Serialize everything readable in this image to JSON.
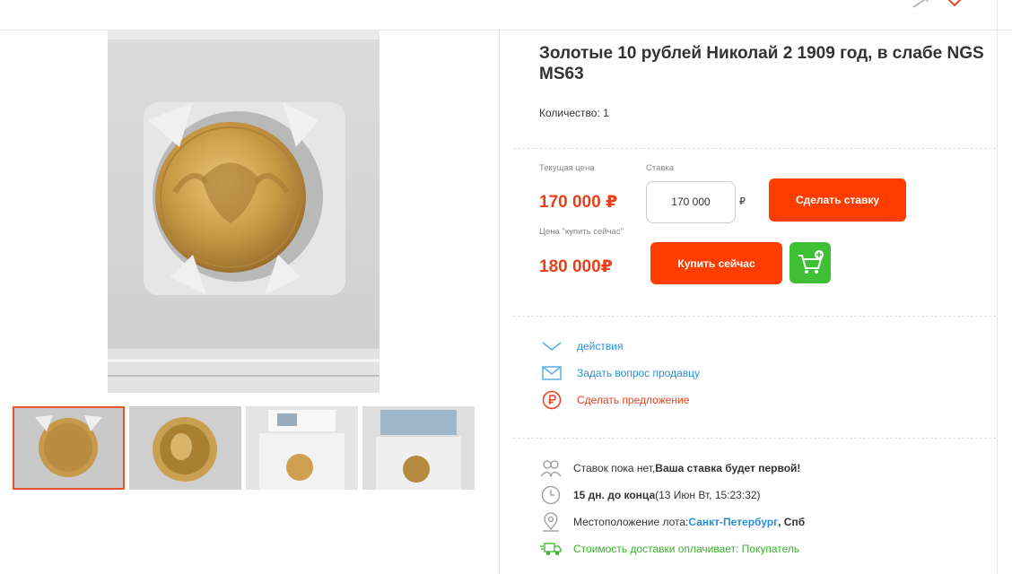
{
  "lot": {
    "title": "Золотые 10 рублей Николай 2 1909 год, в слабе NGS MS63",
    "quantity": "Количество: 1"
  },
  "pricing": {
    "current_label": "Текущая цена",
    "current_price": "170 000 ₽",
    "bid_label": "Ставка",
    "bid_value": "170 000",
    "bid_currency": "₽",
    "bid_button": "Сделать ставку",
    "buy_now_label": "Цена \"купить сейчас\"",
    "buy_now_price": "180 000₽",
    "buy_now_button": "Купить сейчас"
  },
  "actions": [
    {
      "label": "действия",
      "icon": "chevron-down-icon"
    },
    {
      "label": "Задать вопрос продавцу",
      "icon": "envelope-icon"
    },
    {
      "label": "Сделать предложение",
      "icon": "ruble-circle-icon"
    }
  ],
  "info": {
    "bids_prefix": "Ставок пока нет, ",
    "bids_strong": "Ваша ставка будет первой!",
    "time_strong": "15 дн. до конца",
    "time_rest": " (13 Июн Вт, 15:23:32)",
    "location_prefix": "Местоположение лота:",
    "location_city": "Санкт-Петербург",
    "location_region": ", Спб",
    "delivery": "Стоимость доставки оплачивает: Покупатель"
  },
  "colors": {
    "accent": "#ff3d00",
    "price": "#e8401c",
    "link": "#2a8fd8",
    "cart": "#3fbf33",
    "delivery": "#36b329"
  },
  "thumbnails_count": 4
}
